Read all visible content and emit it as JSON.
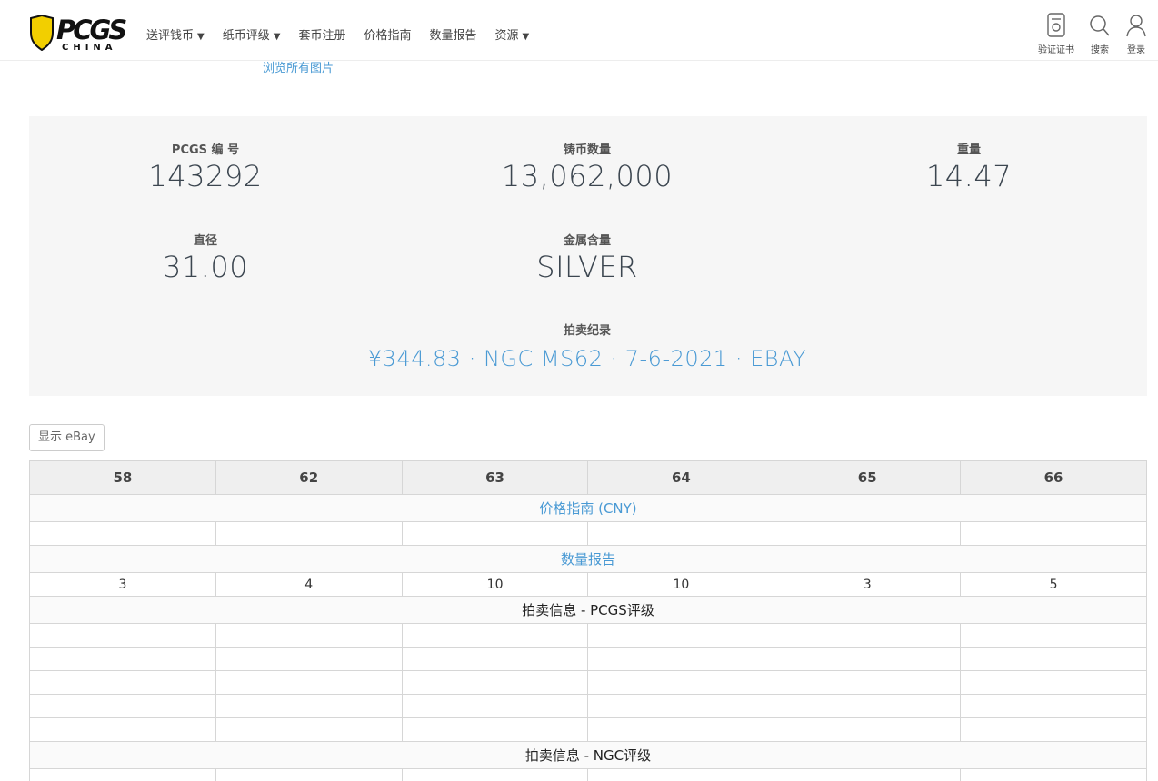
{
  "header": {
    "logo": {
      "brand": "PCGS",
      "sub": "CHINA"
    },
    "nav": [
      {
        "label": "送评钱币",
        "caret": "▼"
      },
      {
        "label": "纸币评级",
        "caret": "▼"
      },
      {
        "label": "套币注册",
        "caret": ""
      },
      {
        "label": "价格指南",
        "caret": ""
      },
      {
        "label": "数量报告",
        "caret": ""
      },
      {
        "label": "资源",
        "caret": "▼"
      }
    ],
    "tools": [
      {
        "label": "验证证书",
        "icon": "certificate-icon"
      },
      {
        "label": "搜索",
        "icon": "search-icon"
      },
      {
        "label": "登录",
        "icon": "user-icon"
      }
    ]
  },
  "browse_link": "浏览所有图片",
  "specs": {
    "pcgs_no": {
      "label": "PCGS 编 号",
      "value": "143292"
    },
    "mintage": {
      "label": "铸币数量",
      "value": "13,062,000"
    },
    "weight": {
      "label": "重量",
      "value": "14.47"
    },
    "diameter": {
      "label": "直径",
      "value": "31.00"
    },
    "metal": {
      "label": "金属含量",
      "value": "SILVER"
    },
    "auction": {
      "label": "拍卖纪录",
      "value": "¥344.83 · NGC MS62 · 7-6-2021 · EBAY"
    }
  },
  "ebay_button": "显示 eBay",
  "table": {
    "grades": [
      "58",
      "62",
      "63",
      "64",
      "65",
      "66"
    ],
    "price_guide_label": "价格指南 (CNY)",
    "population_label": "数量报告",
    "population": [
      "3",
      "4",
      "10",
      "10",
      "3",
      "5"
    ],
    "pcgs_auction_label": "拍卖信息 - PCGS评级",
    "ngc_auction_label": "拍卖信息 - NGC评级"
  },
  "colors": {
    "link": "#4a9ad4",
    "panel_bg": "#f6f6f6",
    "logo_yellow": "#f2cf00"
  }
}
